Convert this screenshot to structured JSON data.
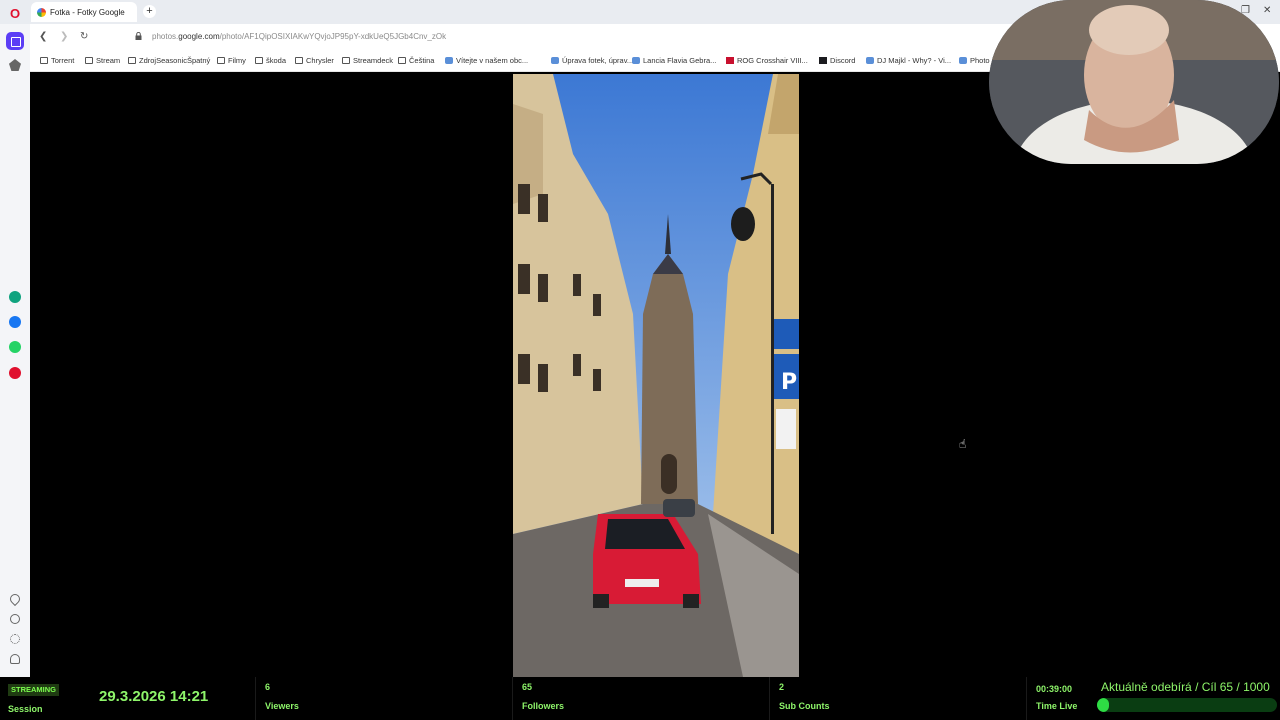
{
  "browser": {
    "tab_title": "Fotka - Fotky Google",
    "url_prefix": "photos.",
    "url_domain": "google.com",
    "url_path": "/photo/AF1QipOSIXIAKwYQvjoJP95pY-xdkUeQ5JGb4Cnv_zOk"
  },
  "bookmarks": [
    {
      "label": "Torrent",
      "icon": "folder-icon"
    },
    {
      "label": "Stream",
      "icon": "folder-icon"
    },
    {
      "label": "ZdrojSeasonicŠpatný",
      "icon": "folder-icon"
    },
    {
      "label": "Filmy",
      "icon": "folder-icon"
    },
    {
      "label": "škoda",
      "icon": "folder-icon"
    },
    {
      "label": "Chrysler",
      "icon": "folder-icon"
    },
    {
      "label": "Streamdeck",
      "icon": "folder-icon"
    },
    {
      "label": "Čeština",
      "icon": "folder-icon"
    },
    {
      "label": "Vítejte v našem obc...",
      "icon": "site-icon"
    },
    {
      "label": "Úprava fotek, úprav...",
      "icon": "site-icon"
    },
    {
      "label": "Lancia Flavia Gebra...",
      "icon": "site-icon"
    },
    {
      "label": "ROG Crosshair VIII...",
      "icon": "rog-icon"
    },
    {
      "label": "Discord",
      "icon": "discord-icon"
    },
    {
      "label": "DJ Majkl - Why? - Vi...",
      "icon": "site-icon"
    },
    {
      "label": "Photo",
      "icon": "site-icon"
    }
  ],
  "stream": {
    "badge": "STREAMING",
    "session_label": "Session",
    "datetime": "29.3.2026 14:21",
    "viewers_count": "6",
    "viewers_label": "Viewers",
    "followers_count": "65",
    "followers_label": "Followers",
    "subs_count": "2",
    "subs_label": "Sub Counts",
    "time_live": "00:39:00",
    "time_live_label": "Time Live",
    "goal_text": "Aktuálně odebírá / Cíl  65 / 1000",
    "goal_progress": 0.065
  },
  "colors": {
    "overlay_green": "#8ef56a",
    "opera_red": "#e0102e",
    "sidebar_accent": "#5b3df5"
  }
}
